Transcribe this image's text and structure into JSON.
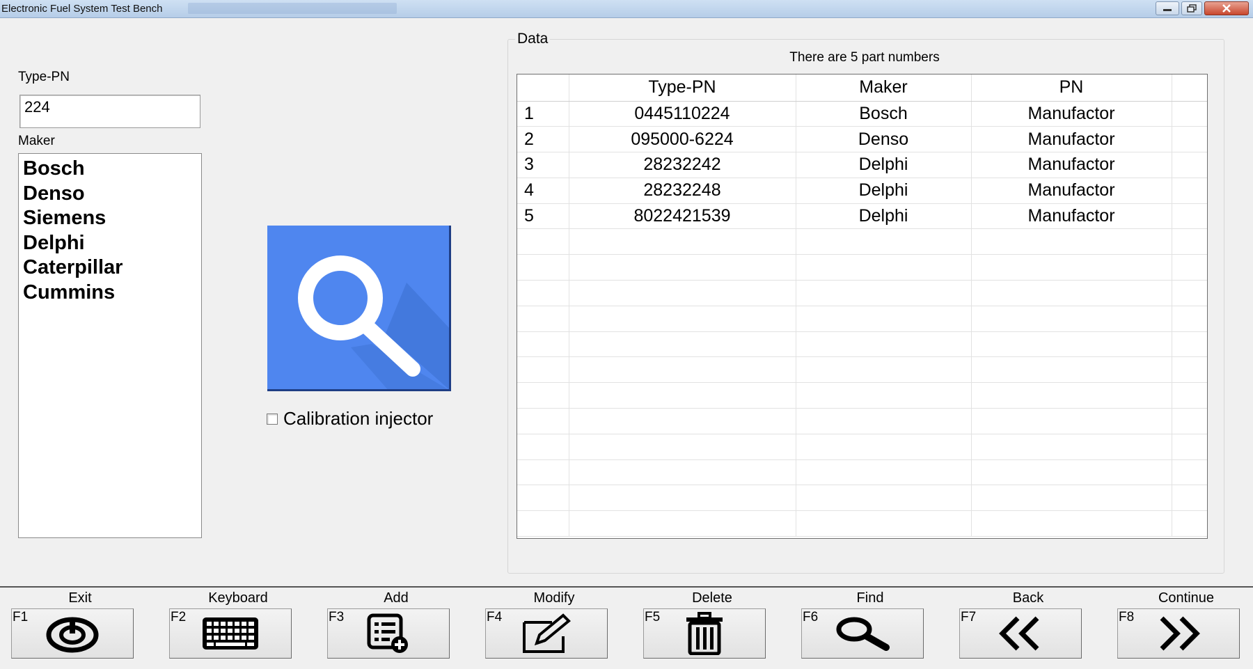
{
  "window": {
    "title": "Electronic Fuel System Test Bench"
  },
  "left": {
    "type_pn_label": "Type-PN",
    "type_pn_value": "224",
    "maker_label": "Maker",
    "makers": [
      "Bosch",
      "Denso",
      "Siemens",
      "Delphi",
      "Caterpillar",
      "Cummins"
    ]
  },
  "search": {
    "icon": "search-icon",
    "color": "#4f86ef"
  },
  "calibration": {
    "label": "Calibration injector",
    "checked": false
  },
  "data_group": {
    "title": "Data",
    "info": "There are 5 part numbers",
    "columns": [
      "",
      "Type-PN",
      "Maker",
      "PN"
    ],
    "rows": [
      [
        "1",
        "0445110224",
        "Bosch",
        "Manufactor"
      ],
      [
        "2",
        "095000-6224",
        "Denso",
        "Manufactor"
      ],
      [
        "3",
        "28232242",
        "Delphi",
        "Manufactor"
      ],
      [
        "4",
        "28232248",
        "Delphi",
        "Manufactor"
      ],
      [
        "5",
        "8022421539",
        "Delphi",
        "Manufactor"
      ]
    ]
  },
  "function_keys": [
    {
      "key": "F1",
      "label": "Exit",
      "icon": "power-icon"
    },
    {
      "key": "F2",
      "label": "Keyboard",
      "icon": "keyboard-icon"
    },
    {
      "key": "F3",
      "label": "Add",
      "icon": "add-list-icon"
    },
    {
      "key": "F4",
      "label": "Modify",
      "icon": "edit-icon"
    },
    {
      "key": "F5",
      "label": "Delete",
      "icon": "trash-icon"
    },
    {
      "key": "F6",
      "label": "Find",
      "icon": "magnifier-icon"
    },
    {
      "key": "F7",
      "label": "Back",
      "icon": "double-chevron-left-icon"
    },
    {
      "key": "F8",
      "label": "Continue",
      "icon": "double-chevron-right-icon"
    }
  ]
}
